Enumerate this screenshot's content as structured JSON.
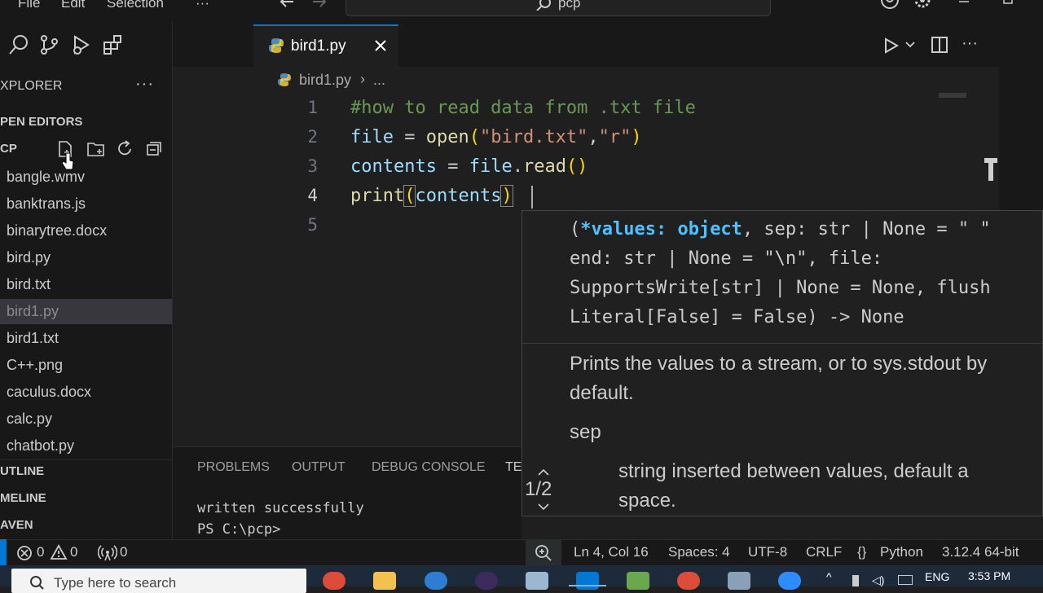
{
  "menu": [
    "File",
    "Edit",
    "Selection",
    "···"
  ],
  "command_center": "pcp",
  "explorer": {
    "title": "XPLORER",
    "open_editors": "PEN EDITORS",
    "folder": "CP",
    "files": [
      "bangle.wmv",
      "banktrans.js",
      "binarytree.docx",
      "bird.py",
      "bird.txt",
      "bird1.py",
      "bird1.txt",
      "C++.png",
      "caculus.docx",
      "calc.py",
      "chatbot.py"
    ],
    "sections": [
      "UTLINE",
      "MELINE",
      "AVEN"
    ]
  },
  "tab": {
    "label": "bird1.py"
  },
  "breadcrumb": {
    "file": "bird1.py",
    "sep": "›",
    "more": "..."
  },
  "code": {
    "line_numbers": [
      "1",
      "2",
      "3",
      "4",
      "5"
    ],
    "l1": "#how to read data from .txt file",
    "l2": {
      "a": "file",
      "b": " = ",
      "c": "open",
      "d": "(",
      "e": "\"bird.txt\"",
      "f": ",",
      "g": "\"r\"",
      "h": ")"
    },
    "l3": {
      "a": "contents",
      "b": " = ",
      "c": "file",
      "d": ".",
      "e": "read",
      "f": "()"
    },
    "l4": {
      "a": "print",
      "b": "(",
      "c": "contents",
      "d": ")"
    }
  },
  "hover": {
    "sig1_a": "(",
    "sig1_b": "*values: object",
    "sig1_c": ", sep: str | None = \" \"",
    "sig2": "end: str | None = \"\\n\", file:",
    "sig3": "SupportsWrite[str] | None = None, flush",
    "sig4": "Literal[False] = False) -> None",
    "doc1": "Prints the values to a stream, or to sys.stdout by",
    "doc2": "default.",
    "param": "sep",
    "param_doc1": "string inserted between values, default a",
    "param_doc2": "space.",
    "overload": "1/2"
  },
  "panel": {
    "tabs": [
      "PROBLEMS",
      "OUTPUT",
      "DEBUG CONSOLE",
      "TE"
    ],
    "term1": "written successfully",
    "term2": "PS C:\\pcp>"
  },
  "status": {
    "errors": "0",
    "warnings": "0",
    "ports": "0",
    "position": "Ln 4, Col 16",
    "spaces": "Spaces: 4",
    "encoding": "UTF-8",
    "eol": "CRLF",
    "language_icon": "{}",
    "language": "Python",
    "interpreter": "3.12.4 64-bit"
  },
  "taskbar": {
    "search_placeholder": "Type here to search",
    "lang": "ENG",
    "time": "3:53 PM"
  },
  "colors": {
    "accent": "#0078d4",
    "comment": "#6a9955",
    "variable": "#9cdcfe",
    "function": "#dcdcaa",
    "string": "#ce9178",
    "bracket": "#ffd700",
    "bracket2": "#da70d6"
  }
}
